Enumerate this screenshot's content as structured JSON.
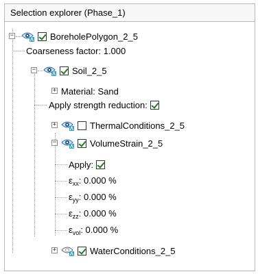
{
  "panel": {
    "title": "Selection explorer (Phase_1)"
  },
  "tree": {
    "borehole": {
      "label": "BoreholePolygon_2_5",
      "checked": true
    },
    "coarseness": {
      "label": "Coarseness factor: 1.000"
    },
    "soil": {
      "label": "Soil_2_5",
      "checked": true
    },
    "material": {
      "label": "Material: Sand"
    },
    "strength": {
      "label": "Apply strength reduction:",
      "checked": true
    },
    "thermal": {
      "label": "ThermalConditions_2_5",
      "checked": false
    },
    "volume": {
      "label": "VolumeStrain_2_5",
      "checked": true
    },
    "apply": {
      "label": "Apply:",
      "checked": true
    },
    "exx": {
      "symbol": "ε",
      "sub": "xx",
      "value": ": 0.000 %"
    },
    "eyy": {
      "symbol": "ε",
      "sub": "yy",
      "value": ": 0.000 %"
    },
    "ezz": {
      "symbol": "ε",
      "sub": "zz",
      "value": ": 0.000 %"
    },
    "evol": {
      "symbol": "ε",
      "sub": "vol",
      "value": ": 0.000 %"
    },
    "water": {
      "label": "WaterConditions_2_5",
      "checked": true
    }
  }
}
